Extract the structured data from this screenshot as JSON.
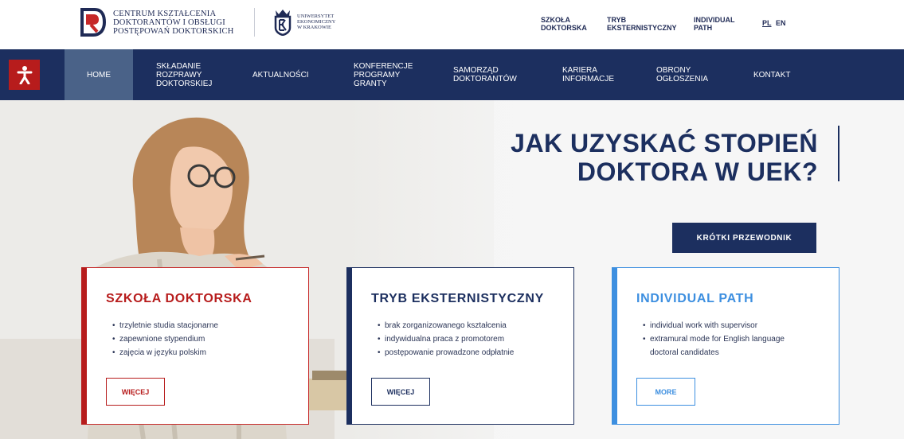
{
  "header": {
    "logo_cd_lines": [
      "CENTRUM KSZTAŁCENIA",
      "DOKTORANTÓW I OBSŁUGI",
      "POSTĘPOWAŃ DOKTORSKICH"
    ],
    "logo_uek_lines": [
      "UNIWERSYTET",
      "EKONOMICZNY",
      "W KRAKOWIE"
    ],
    "links": [
      {
        "line1": "SZKOŁA",
        "line2": "DOKTORSKA"
      },
      {
        "line1": "TRYB",
        "line2": "EKSTERNISTYCZNY"
      },
      {
        "line1": "INDIVIDUAL",
        "line2": "PATH"
      }
    ],
    "lang_pl": "PL",
    "lang_en": "EN"
  },
  "nav": {
    "items": [
      {
        "label": "HOME"
      },
      {
        "label": "SKŁADANIE ROZPRAWY DOKTORSKIEJ"
      },
      {
        "label": "AKTUALNOŚCI"
      },
      {
        "label": "KONFERENCJE PROGRAMY GRANTY"
      },
      {
        "label": "SAMORZĄD DOKTORANTÓW"
      },
      {
        "label": "KARIERA INFORMACJE"
      },
      {
        "label": "OBRONY OGŁOSZENIA"
      },
      {
        "label": "KONTAKT"
      }
    ]
  },
  "hero": {
    "title_line1": "JAK UZYSKAĆ STOPIEŃ",
    "title_line2": "DOKTORA W UEK?",
    "guide_button": "KRÓTKI PRZEWODNIK"
  },
  "cards": [
    {
      "title": "SZKOŁA DOKTORSKA",
      "items": [
        "trzyletnie studia stacjonarne",
        "zapewnione stypendium",
        "zajęcia w języku polskim"
      ],
      "button": "WIĘCEJ"
    },
    {
      "title": "TRYB EKSTERNISTYCZNY",
      "items": [
        "brak zorganizowanego kształcenia",
        "indywidualna praca z promotorem",
        "postępowanie prowadzone odpłatnie"
      ],
      "button": "WIĘCEJ"
    },
    {
      "title": "INDIVIDUAL PATH",
      "items": [
        "individual work with supervisor",
        "extramural mode for English language",
        "doctoral candidates"
      ],
      "button": "MORE"
    }
  ],
  "colors": {
    "navy": "#1c2f5f",
    "red": "#b71c1c",
    "blue": "#3d8fe0",
    "nav_active": "#4a6288"
  },
  "icons": {
    "accessibility": "accessibility-icon"
  }
}
